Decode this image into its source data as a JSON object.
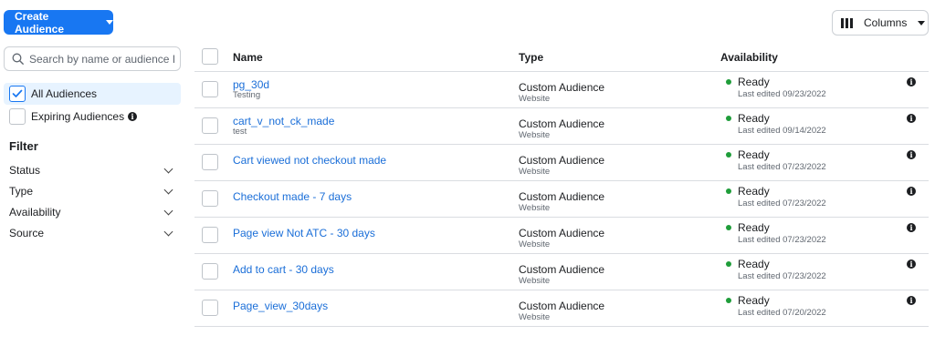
{
  "toolbar": {
    "create_label": "Create Audience",
    "columns_label": "Columns"
  },
  "sidebar": {
    "search_placeholder": "Search by name or audience ID",
    "audience_filters": [
      {
        "label": "All Audiences",
        "checked": true
      },
      {
        "label": "Expiring Audiences",
        "checked": false
      }
    ],
    "filter_title": "Filter",
    "filters": [
      "Status",
      "Type",
      "Availability",
      "Source"
    ]
  },
  "table": {
    "headers": {
      "name": "Name",
      "type": "Type",
      "availability": "Availability"
    },
    "rows": [
      {
        "name": "pg_30d",
        "sub": "Testing",
        "type": "Custom Audience",
        "type_sub": "Website",
        "status": "Ready",
        "edited": "Last edited 09/23/2022"
      },
      {
        "name": "cart_v_not_ck_made",
        "sub": "test",
        "type": "Custom Audience",
        "type_sub": "Website",
        "status": "Ready",
        "edited": "Last edited 09/14/2022"
      },
      {
        "name": "Cart viewed not checkout made",
        "sub": "",
        "type": "Custom Audience",
        "type_sub": "Website",
        "status": "Ready",
        "edited": "Last edited 07/23/2022"
      },
      {
        "name": "Checkout made - 7 days",
        "sub": "",
        "type": "Custom Audience",
        "type_sub": "Website",
        "status": "Ready",
        "edited": "Last edited 07/23/2022"
      },
      {
        "name": "Page view Not ATC - 30 days",
        "sub": "",
        "type": "Custom Audience",
        "type_sub": "Website",
        "status": "Ready",
        "edited": "Last edited 07/23/2022"
      },
      {
        "name": "Add to cart - 30 days",
        "sub": "",
        "type": "Custom Audience",
        "type_sub": "Website",
        "status": "Ready",
        "edited": "Last edited 07/23/2022"
      },
      {
        "name": "Page_view_30days",
        "sub": "",
        "type": "Custom Audience",
        "type_sub": "Website",
        "status": "Ready",
        "edited": "Last edited 07/20/2022"
      }
    ]
  },
  "colors": {
    "accent": "#1877f2",
    "link": "#1a6ed8",
    "ready": "#1f9d3a"
  }
}
